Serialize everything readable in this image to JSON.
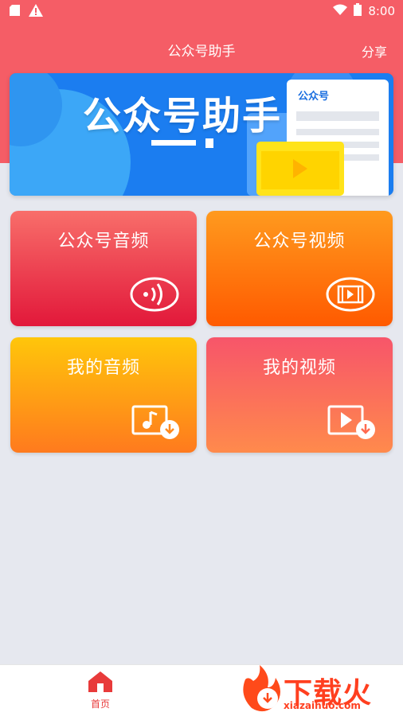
{
  "status_bar": {
    "time": "8:00",
    "left_icons": [
      "sd-card-icon",
      "alert-icon"
    ],
    "right_icons": [
      "wifi-icon",
      "battery-icon"
    ]
  },
  "header": {
    "title": "公众号助手",
    "share_label": "分享"
  },
  "banner": {
    "title": "公众号助手",
    "card_label": "公众号"
  },
  "tiles": [
    {
      "label": "公众号音频",
      "icon": "audio-wave-icon"
    },
    {
      "label": "公众号视频",
      "icon": "film-icon"
    },
    {
      "label": "我的音频",
      "icon": "music-download-icon"
    },
    {
      "label": "我的视频",
      "icon": "video-download-icon"
    }
  ],
  "bottom_nav": {
    "home_label": "首页",
    "home_icon": "home-icon"
  },
  "watermark": {
    "text": "下载火",
    "sub": "xiazaihuo.com"
  },
  "colors": {
    "header": "#f55d66",
    "banner": "#1b7df0",
    "accent_red": "#e83a3a"
  }
}
